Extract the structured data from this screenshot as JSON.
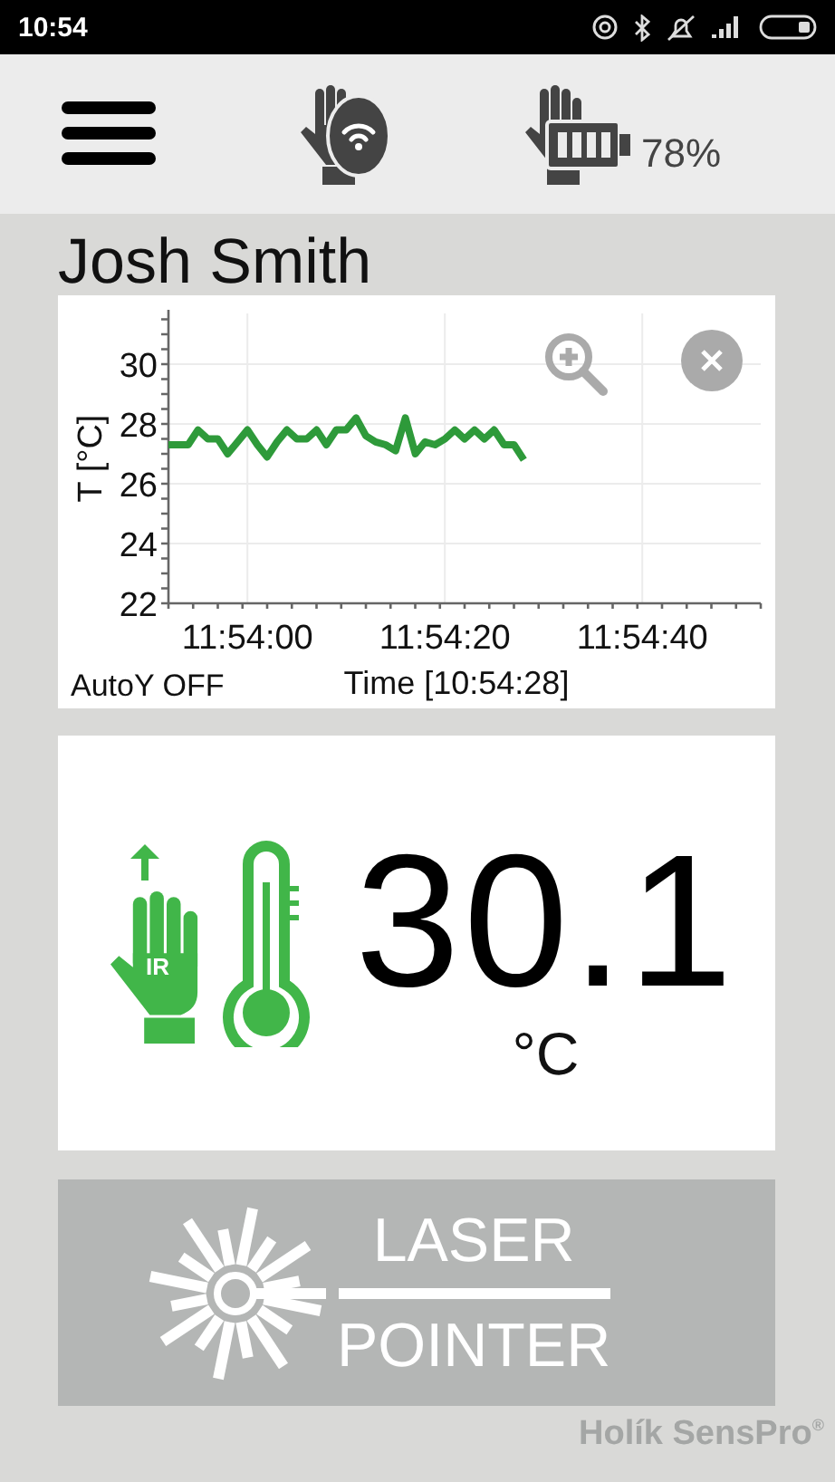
{
  "status_bar": {
    "time": "10:54"
  },
  "header": {
    "battery": "78%"
  },
  "patient": {
    "name": "Josh Smith"
  },
  "chart": {
    "autoy": "AutoY OFF",
    "chart_data": {
      "type": "line",
      "xlabel": "Time [10:54:28]",
      "ylabel": "T [°C]",
      "categories": [
        null,
        null,
        null,
        null,
        null,
        null,
        null,
        null,
        "11:54:00",
        null,
        null,
        null,
        null,
        null,
        null,
        null,
        null,
        null,
        null,
        null,
        null,
        null,
        null,
        null,
        null,
        null,
        null,
        null,
        "11:54:20",
        null,
        null,
        null,
        null,
        null,
        null,
        null,
        null,
        null,
        null,
        null,
        null,
        null,
        null,
        null,
        null,
        null,
        null,
        null,
        "11:54:40",
        null,
        null,
        null,
        null,
        null,
        null,
        null,
        null,
        null,
        null,
        null,
        null
      ],
      "series": [
        {
          "color": "#2e9a3a",
          "values": [
            27.3,
            27.3,
            27.3,
            27.8,
            27.5,
            27.5,
            27.0,
            27.4,
            27.8,
            27.3,
            26.9,
            27.4,
            27.8,
            27.5,
            27.5,
            27.8,
            27.3,
            27.8,
            27.8,
            28.2,
            27.6,
            27.4,
            27.3,
            27.1,
            28.2,
            27.0,
            27.4,
            27.3,
            27.5,
            27.8,
            27.5,
            27.8,
            27.5,
            27.8,
            27.3,
            27.3,
            26.8,
            null,
            null,
            null,
            null,
            null,
            null,
            null,
            null,
            null,
            null,
            null,
            null,
            null,
            null,
            null,
            null,
            null,
            null,
            null,
            null,
            null,
            null,
            null,
            null
          ]
        }
      ],
      "grid": true,
      "ylim": [
        22,
        31.7
      ],
      "yticks": [
        22,
        24,
        26,
        28,
        30
      ]
    }
  },
  "reading": {
    "sensor_label": "IR",
    "value": "30.1",
    "unit": "°C"
  },
  "laser_button": {
    "lines": [
      "LASER",
      "POINTER"
    ]
  },
  "brand": "Holík SensPro$^{®}$"
}
